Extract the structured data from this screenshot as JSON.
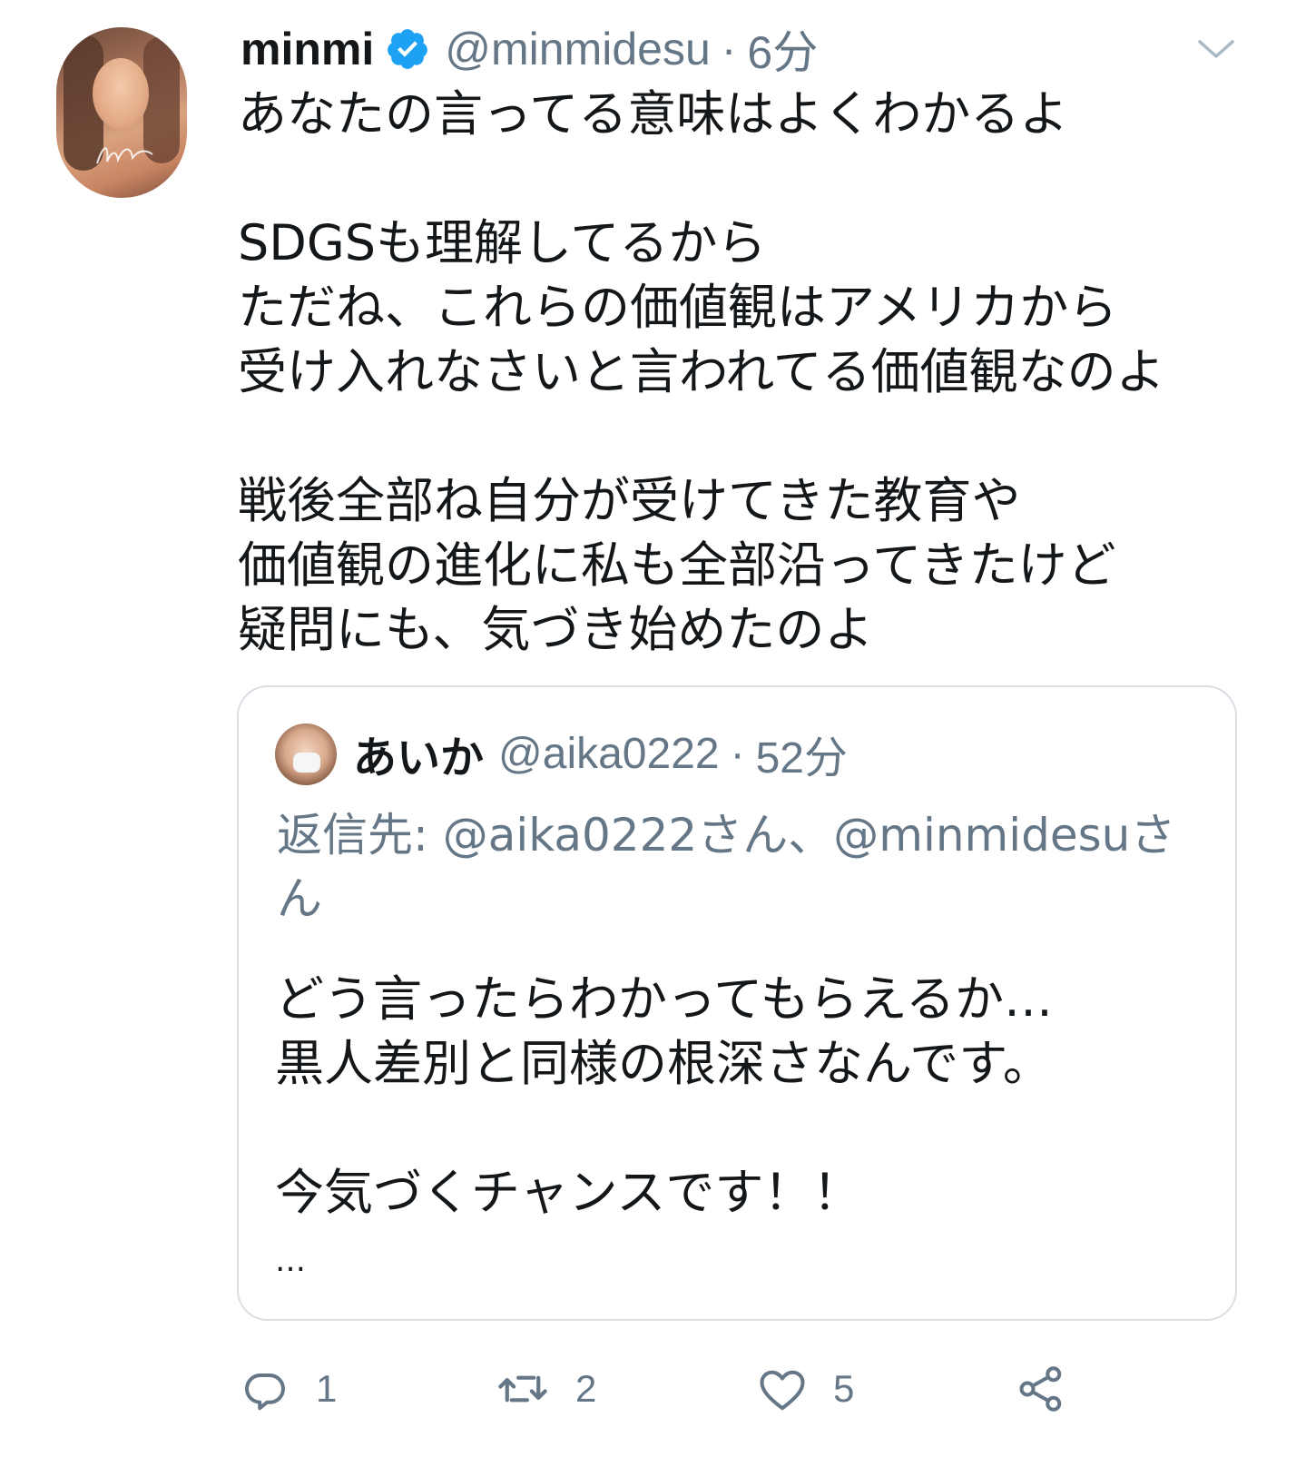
{
  "tweet": {
    "display_name": "minmi",
    "verified": true,
    "handle": "@minmidesu",
    "separator": "·",
    "time": "6分",
    "body": "あなたの言ってる意味はよくわかるよ\n\nSDGSも理解してるから\nただね、これらの価値観はアメリカから\n受け入れなさいと言われてる価値観なのよ\n\n戦後全部ね自分が受けてきた教育や\n価値観の進化に私も全部沿ってきたけど\n疑問にも、気づき始めたのよ"
  },
  "quote": {
    "display_name": "あいか",
    "handle": "@aika0222",
    "separator": "·",
    "time": "52分",
    "reply_prefix": "返信先: ",
    "reply_mentions": "@aika0222さん、@minmidesuさん",
    "body": "どう言ったらわかってもらえるか…\n黒人差別と同様の根深さなんです。\n\n今気づくチャンスです！！",
    "truncation": "…"
  },
  "actions": {
    "reply_count": "1",
    "retweet_count": "2",
    "like_count": "5"
  },
  "colors": {
    "text_primary": "#14171a",
    "text_secondary": "#657786",
    "verified_blue": "#1da1f2",
    "border": "#d8dfe5"
  }
}
